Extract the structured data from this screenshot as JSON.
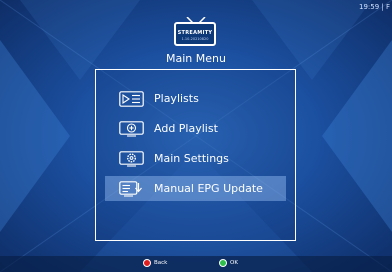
{
  "status": {
    "clock": "19:59 | F"
  },
  "app": {
    "logo_text": "STREAMITY",
    "version": "1.10-20210820"
  },
  "menu": {
    "title": "Main Menu",
    "items": [
      {
        "label": "Playlists",
        "icon": "playlist-icon",
        "selected": false
      },
      {
        "label": "Add Playlist",
        "icon": "add-icon",
        "selected": false
      },
      {
        "label": "Main Settings",
        "icon": "gear-icon",
        "selected": false
      },
      {
        "label": "Manual EPG Update",
        "icon": "epg-download-icon",
        "selected": true
      }
    ]
  },
  "hints": [
    {
      "label": "Back",
      "color": "#e02020"
    },
    {
      "label": "OK",
      "color": "#2fbf4a"
    }
  ]
}
